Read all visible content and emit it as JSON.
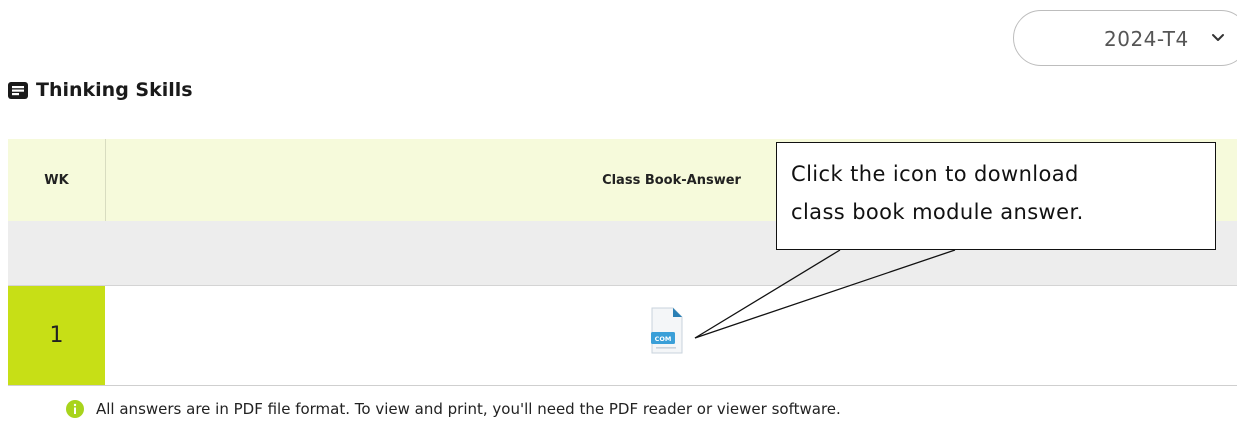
{
  "term_select": {
    "value": "2024-T4",
    "icon": "chevron-down-icon"
  },
  "section": {
    "title": "Thinking Skills",
    "icon": "list-icon"
  },
  "table": {
    "headers": {
      "week": "WK",
      "answer": "Class Book-Answer"
    },
    "rows": [
      {
        "week": "1",
        "file_icon_label": "COM",
        "file_icon": "document-download-icon"
      }
    ]
  },
  "note": {
    "icon": "info-icon",
    "text": "All answers are in PDF file format. To view and print, you'll need the PDF reader or viewer software."
  },
  "callout": {
    "line1": "Click the icon to download",
    "line2": "class book module answer."
  },
  "colors": {
    "header_bg": "#f6fadb",
    "week_cell_bg": "#c7df16",
    "gray_row_bg": "#ededed",
    "info_icon": "#a8d41c",
    "file_icon_blue": "#3a9fd8"
  }
}
